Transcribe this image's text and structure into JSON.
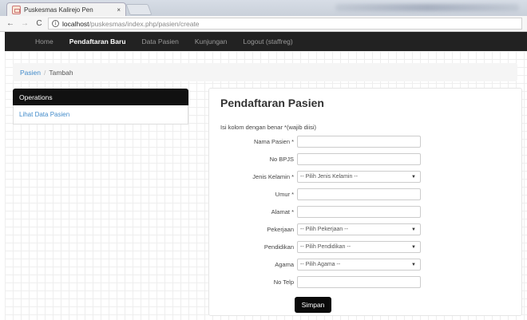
{
  "browser": {
    "tab_title": "Puskesmas Kalirejo Pen",
    "tab_close": "×",
    "url_host": "localhost",
    "url_path": "/puskesmas/index.php/pasien/create"
  },
  "icons": {
    "back": "←",
    "forward": "→",
    "reload": "C",
    "info": "i",
    "caret": "▼"
  },
  "navbar": {
    "items": [
      {
        "label": "Home",
        "active": false
      },
      {
        "label": "Pendaftaran Baru",
        "active": true
      },
      {
        "label": "Data Pasien",
        "active": false
      },
      {
        "label": "Kunjungan",
        "active": false
      },
      {
        "label": "Logout (staffreg)",
        "active": false
      }
    ]
  },
  "breadcrumb": {
    "parent": "Pasien",
    "separator": "/",
    "current": "Tambah"
  },
  "sidebar": {
    "heading": "Operations",
    "items": [
      "Lihat Data Pasien"
    ]
  },
  "form": {
    "title": "Pendaftaran Pasien",
    "hint": "Isi kolom dengan benar  *(wajib diisi)",
    "fields": [
      {
        "label": "Nama Pasien *",
        "type": "text",
        "value": ""
      },
      {
        "label": "No BPJS",
        "type": "text",
        "value": ""
      },
      {
        "label": "Jenis Kelamin *",
        "type": "select",
        "value": "-- Pilih Jenis Kelamin --"
      },
      {
        "label": "Umur *",
        "type": "text",
        "value": ""
      },
      {
        "label": "Alamat *",
        "type": "text",
        "value": ""
      },
      {
        "label": "Pekerjaan",
        "type": "select",
        "value": "-- Pilih Pekerjaan --"
      },
      {
        "label": "Pendidikan",
        "type": "select",
        "value": "-- Pilih Pendidikan --"
      },
      {
        "label": "Agama",
        "type": "select",
        "value": "-- Pilih Agama --"
      },
      {
        "label": "No Telp",
        "type": "text",
        "value": ""
      }
    ],
    "submit_label": "Simpan"
  }
}
